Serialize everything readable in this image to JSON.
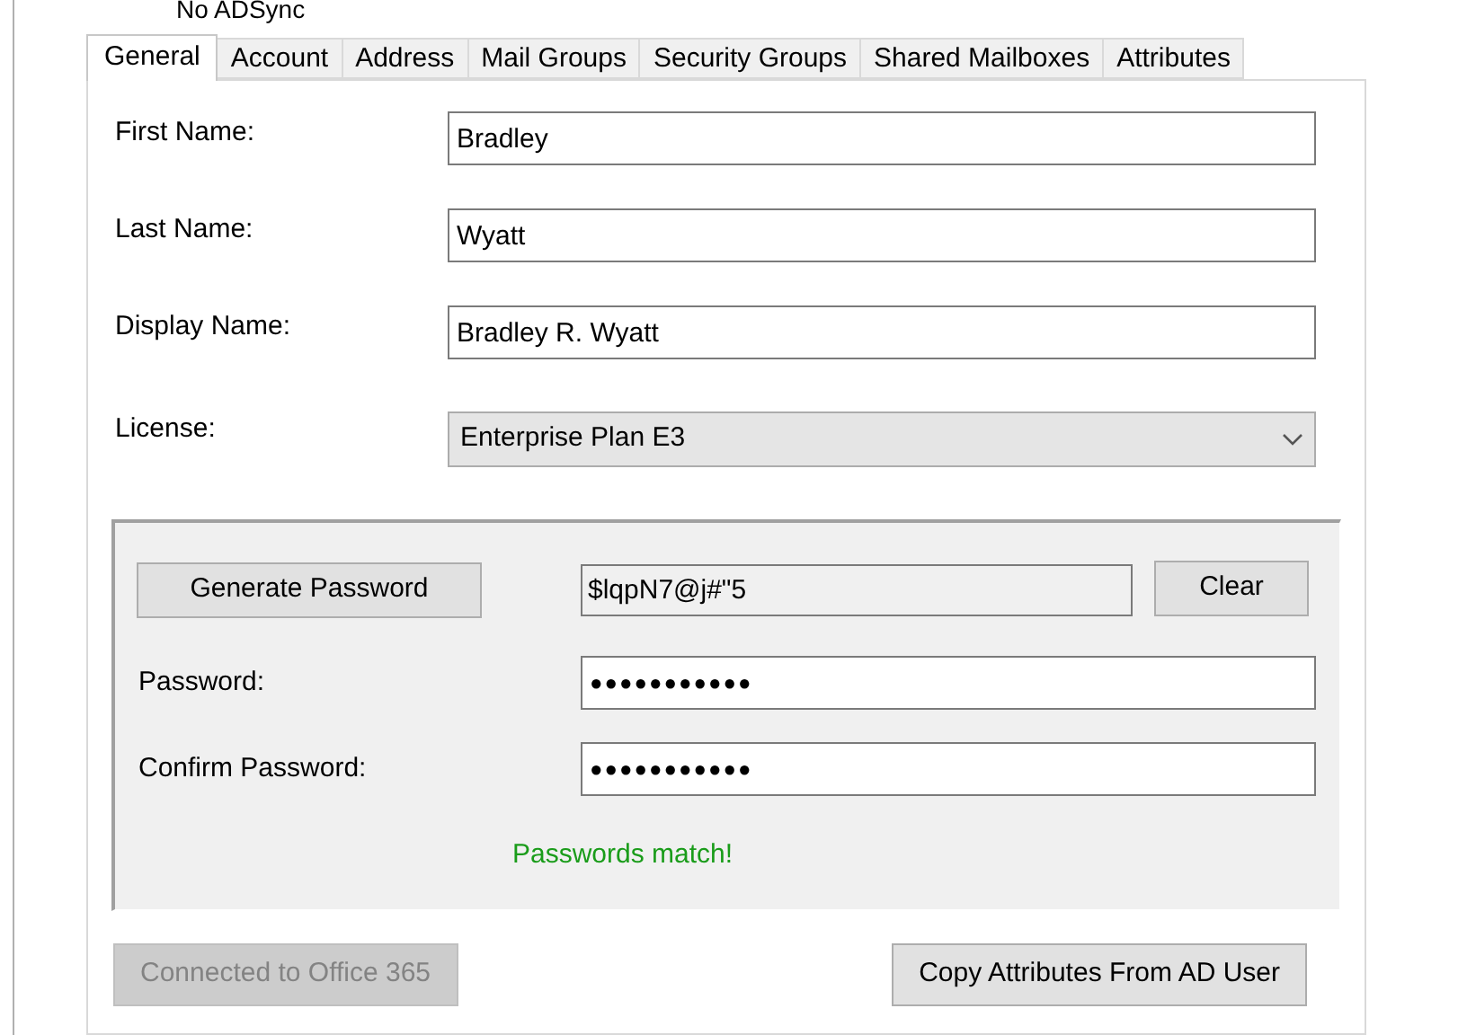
{
  "header": {
    "title": "No ADSync"
  },
  "tabs": [
    {
      "label": "General",
      "selected": true
    },
    {
      "label": "Account",
      "selected": false
    },
    {
      "label": "Address",
      "selected": false
    },
    {
      "label": "Mail Groups",
      "selected": false
    },
    {
      "label": "Security Groups",
      "selected": false
    },
    {
      "label": "Shared Mailboxes",
      "selected": false
    },
    {
      "label": "Attributes",
      "selected": false
    }
  ],
  "fields": [
    {
      "kind": "text",
      "label": "First Name:",
      "value": "Bradley"
    },
    {
      "kind": "text",
      "label": "Last Name:",
      "value": "Wyatt"
    },
    {
      "kind": "text",
      "label": "Display Name:",
      "value": "Bradley R. Wyatt"
    },
    {
      "kind": "dropdown",
      "label": "License:",
      "value": "Enterprise Plan E3"
    }
  ],
  "password_group": {
    "generate_button": "Generate Password",
    "generated_value": "$lqpN7@j#\"5",
    "clear_button": "Clear",
    "password": {
      "label": "Password:",
      "value": "●●●●●●●●●●●"
    },
    "confirm": {
      "label": "Confirm Password:",
      "value": "●●●●●●●●●●●"
    },
    "status": "Passwords match!"
  },
  "buttons": [
    {
      "label": "Connected to Office 365",
      "disabled": true
    },
    {
      "label": "Copy Attributes From AD User",
      "disabled": false
    }
  ]
}
